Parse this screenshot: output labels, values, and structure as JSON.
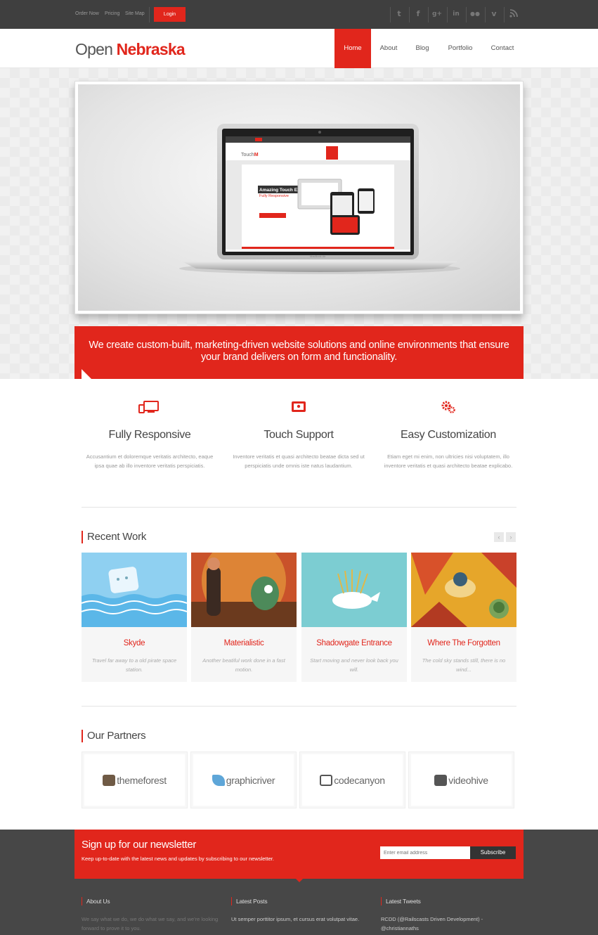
{
  "topbar": {
    "links": [
      "Order Now",
      "Pricing",
      "Site Map"
    ],
    "login_label": "Login",
    "social_icons": [
      "twitter-icon",
      "facebook-icon",
      "google-plus-icon",
      "linkedin-icon",
      "flickr-icon",
      "vimeo-icon",
      "rss-icon"
    ]
  },
  "header": {
    "logo_part1": "Open",
    "logo_part2": "Nebraska",
    "nav": [
      "Home",
      "About",
      "Blog",
      "Portfolio",
      "Contact"
    ],
    "active_nav": "Home"
  },
  "hero": {
    "banner_text": "We create custom-built, marketing-driven website solutions and online environments that ensure your brand delivers on form and functionality."
  },
  "features": [
    {
      "icon": "responsive-devices-icon",
      "title": "Fully Responsive",
      "text": "Accusantium et doloremque veritatis architecto, eaque ipsa quae ab illo inventore veritatis perspiciatis."
    },
    {
      "icon": "touch-tablet-icon",
      "title": "Touch Support",
      "text": "Inventore veritatis et quasi architecto beatae dicta sed ut perspiciatis unde omnis iste natus laudantium."
    },
    {
      "icon": "gears-icon",
      "title": "Easy Customization",
      "text": "Etiam eget mi enim, non ultricies nisi voluptatem, illo inventore veritatis et quasi architecto beatae explicabo."
    }
  ],
  "recent_work": {
    "heading": "Recent Work",
    "items": [
      {
        "title": "Skyde",
        "text": "Travel far away to a old pirate space station."
      },
      {
        "title": "Materialistic",
        "text": "Another beatiful work done in a fast motion."
      },
      {
        "title": "Shadowgate Entrance",
        "text": "Start moving and never look back you will."
      },
      {
        "title": "Where The Forgotten",
        "text": "The cold sky stands still, there is no wind..."
      }
    ]
  },
  "partners": {
    "heading": "Our Partners",
    "items": [
      "themeforest",
      "graphicriver",
      "codecanyon",
      "videohive"
    ]
  },
  "newsletter": {
    "title": "Sign up for our newsletter",
    "text": "Keep up-to-date with the latest news and updates by subscribing to our newsletter.",
    "placeholder": "Enter email address",
    "button": "Subscribe"
  },
  "footer": {
    "columns": [
      {
        "heading": "About Us",
        "text": "We say what we do, we do what we say, and we're looking forward to prove it to you."
      },
      {
        "heading": "Latest Posts",
        "text": "Ut semper porttitor ipsum, et cursus erat volutpat vitae."
      },
      {
        "heading": "Latest Tweets",
        "text": "RCDD (@Railscasts Driven Development) - @christiannaths"
      }
    ]
  },
  "colors": {
    "accent": "#e1261c",
    "topbar": "#3f3f3f",
    "footer": "#474747"
  }
}
